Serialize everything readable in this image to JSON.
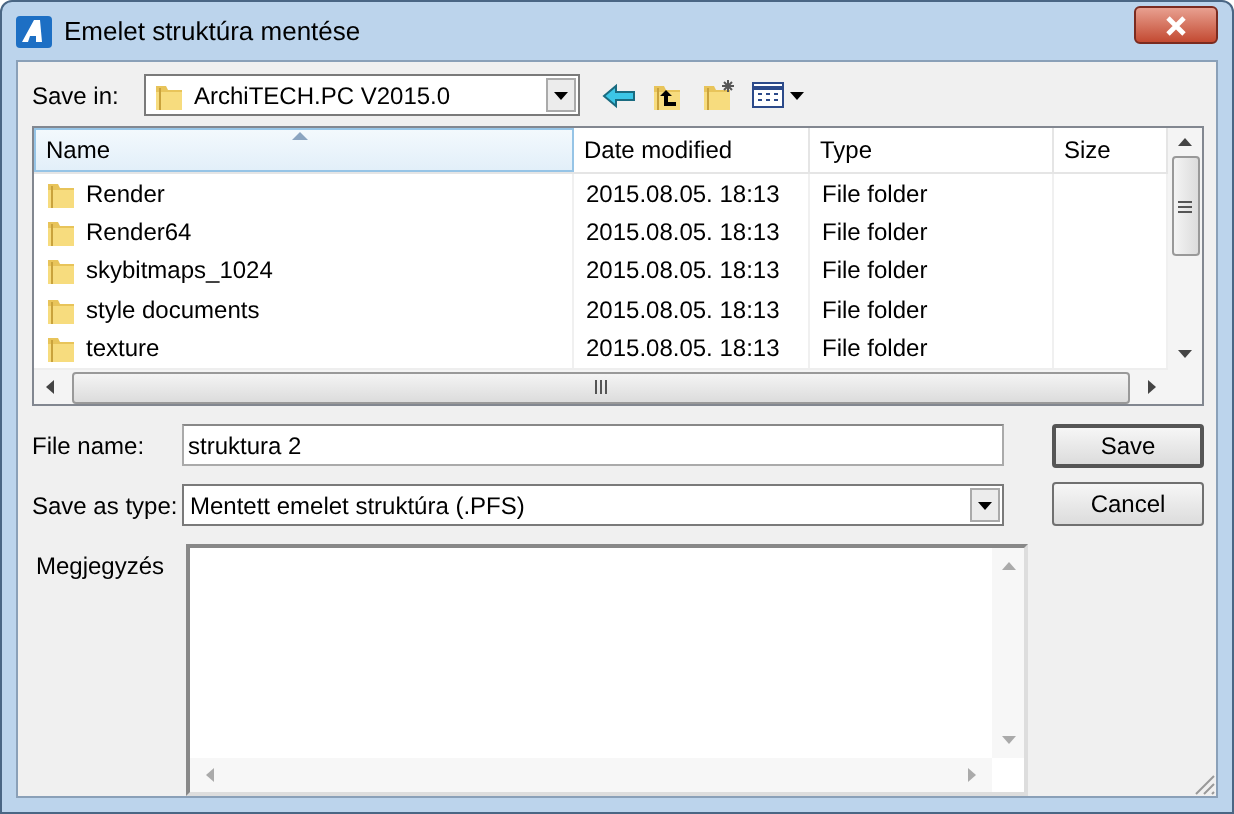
{
  "window": {
    "title": "Emelet struktúra mentése"
  },
  "save_in": {
    "label": "Save in:",
    "value": "ArchiTECH.PC V2015.0"
  },
  "file_list": {
    "columns": [
      {
        "label": "Name",
        "sorted": true
      },
      {
        "label": "Date modified",
        "sorted": false
      },
      {
        "label": "Type",
        "sorted": false
      },
      {
        "label": "Size",
        "sorted": false
      }
    ],
    "rows": [
      {
        "name": "Render",
        "date": "2015.08.05. 18:13",
        "type": "File folder"
      },
      {
        "name": "Render64",
        "date": "2015.08.05. 18:13",
        "type": "File folder"
      },
      {
        "name": "skybitmaps_1024",
        "date": "2015.08.05. 18:13",
        "type": "File folder"
      },
      {
        "name": "style documents",
        "date": "2015.08.05. 18:13",
        "type": "File folder"
      },
      {
        "name": "texture",
        "date": "2015.08.05. 18:13",
        "type": "File folder"
      }
    ]
  },
  "file_name": {
    "label": "File name:",
    "value": "struktura 2"
  },
  "save_as_type": {
    "label": "Save as type:",
    "value": "Mentett emelet struktúra (.PFS)"
  },
  "note": {
    "label": "Megjegyzés"
  },
  "buttons": [
    "Save",
    "Cancel"
  ]
}
